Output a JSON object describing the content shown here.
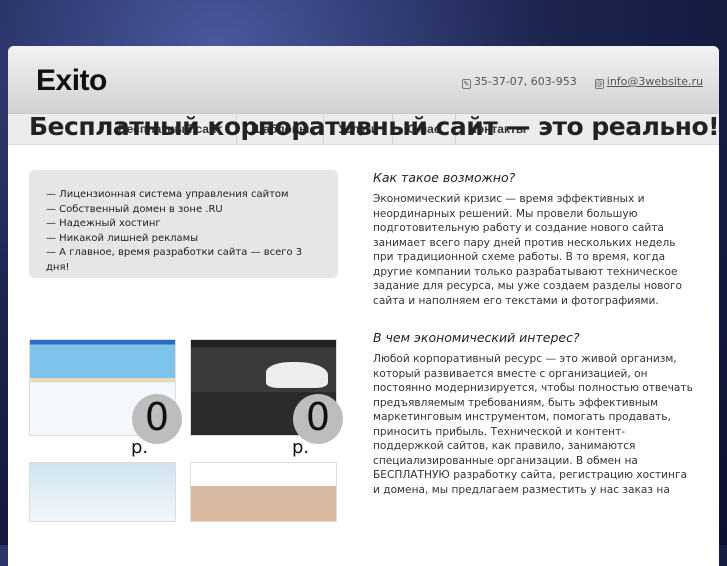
{
  "header": {
    "logo": "Exito",
    "phone": "35-37-07, 603-953",
    "email": "info@3website.ru"
  },
  "nav": [
    "Бесплатный сайт",
    "Шаблоны",
    "Услуги",
    "О нас",
    "Контакты"
  ],
  "headline": "Бесплатный корпоративный сайт — это реально!",
  "features": [
    "— Лицензионная система управления сайтом",
    "— Собственный домен в зоне .RU",
    "— Надежный хостинг",
    "— Никакой лишней рекламы",
    "— А главное, время разработки сайта — всего 3 дня!"
  ],
  "sections": [
    {
      "title": "Как такое возможно?",
      "text": "Экономический кризис — время эффективных и неординарных решений. Мы провели большую подготовительную работу и создание нового сайта занимает всего пару дней против нескольких недель при традиционной схеме работы. В то время, когда другие компании только разрабатывают техническое задание для ресурса, мы уже создаем разделы нового сайта и наполняем его текстами и фотографиями."
    },
    {
      "title": "В чем экономический интерес?",
      "text": "Любой корпоративный ресурс — это живой организм, который развивается вместе с организацией, он постоянно модернизируется, чтобы полностью отвечать предъявляемым требованиям, быть эффективным маркетинговым инструментом, помогать продавать, приносить прибыль. Технической и контент-поддержкой сайтов, как правило, занимаются специализированные организации. В обмен на БЕСПЛАТНУЮ разработку сайта, регистрацию хостинга и домена, мы предлагаем разместить у нас заказ на"
    }
  ],
  "templates": [
    {
      "price": "0",
      "currency": "р."
    },
    {
      "price": "0",
      "currency": "р."
    }
  ]
}
